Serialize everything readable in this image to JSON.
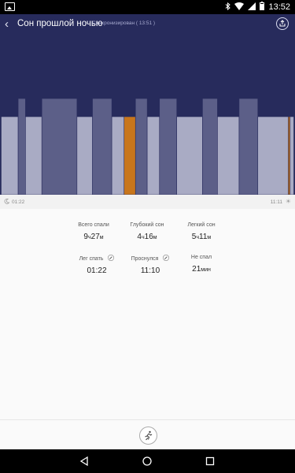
{
  "statusbar": {
    "time": "13:52"
  },
  "header": {
    "title": "Сон прошлой ночью",
    "sync_status": "Синхронизирован ( 13:51 )"
  },
  "timeline": {
    "start": "01:22",
    "end": "11:11"
  },
  "stats": [
    {
      "label": "Всего спали",
      "hours": "9",
      "h_unit": "ч",
      "minutes": "27",
      "m_unit": "м"
    },
    {
      "label": "Глубокий сон",
      "hours": "4",
      "h_unit": "ч",
      "minutes": "16",
      "m_unit": "м"
    },
    {
      "label": "Легкий сон",
      "hours": "5",
      "h_unit": "ч",
      "minutes": "11",
      "m_unit": "м"
    },
    {
      "label": "Лег спать",
      "value": "01:22"
    },
    {
      "label": "Проснулся",
      "value": "11:10"
    },
    {
      "label": "Не спал",
      "hours": "21",
      "h_unit": "мин"
    }
  ],
  "colors": {
    "background": "#272b5c",
    "deep_sleep": "#5c5f88",
    "light_sleep": "#a9abc4",
    "awake": "#c8761c"
  },
  "chart_data": {
    "type": "bar",
    "series": [
      {
        "stage": "light",
        "start": 0,
        "end": 0.058
      },
      {
        "stage": "deep",
        "start": 0.058,
        "end": 0.083
      },
      {
        "stage": "light",
        "start": 0.083,
        "end": 0.139
      },
      {
        "stage": "deep",
        "start": 0.139,
        "end": 0.259
      },
      {
        "stage": "light",
        "start": 0.259,
        "end": 0.312
      },
      {
        "stage": "deep",
        "start": 0.312,
        "end": 0.378
      },
      {
        "stage": "light",
        "start": 0.378,
        "end": 0.42
      },
      {
        "stage": "awake",
        "start": 0.42,
        "end": 0.459
      },
      {
        "stage": "light",
        "start": 0.459,
        "end": 0.459
      },
      {
        "stage": "deep",
        "start": 0.459,
        "end": 0.499
      },
      {
        "stage": "light",
        "start": 0.499,
        "end": 0.541
      },
      {
        "stage": "deep",
        "start": 0.541,
        "end": 0.6
      },
      {
        "stage": "light",
        "start": 0.6,
        "end": 0.688
      },
      {
        "stage": "deep",
        "start": 0.688,
        "end": 0.739
      },
      {
        "stage": "light",
        "start": 0.739,
        "end": 0.813
      },
      {
        "stage": "deep",
        "start": 0.813,
        "end": 0.877
      },
      {
        "stage": "light",
        "start": 0.877,
        "end": 0.981
      },
      {
        "stage": "awake",
        "start": 0.981,
        "end": 0.987
      },
      {
        "stage": "light",
        "start": 0.987,
        "end": 1.0
      }
    ]
  }
}
